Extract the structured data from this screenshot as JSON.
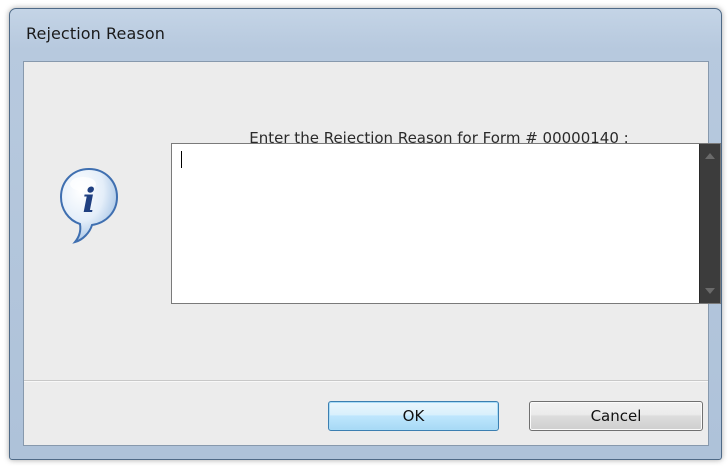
{
  "dialog": {
    "title": "Rejection Reason",
    "prompt": "Enter the Rejection Reason for Form # 00000140 :",
    "textarea_value": "",
    "icon": "info-speech-bubble-icon",
    "buttons": {
      "ok_label": "OK",
      "cancel_label": "Cancel"
    }
  },
  "colors": {
    "titlebar": "#b7c9de",
    "client_bg": "#ececec",
    "default_button_border": "#3c7fb1",
    "scrollbar": "#3c3c3c"
  }
}
